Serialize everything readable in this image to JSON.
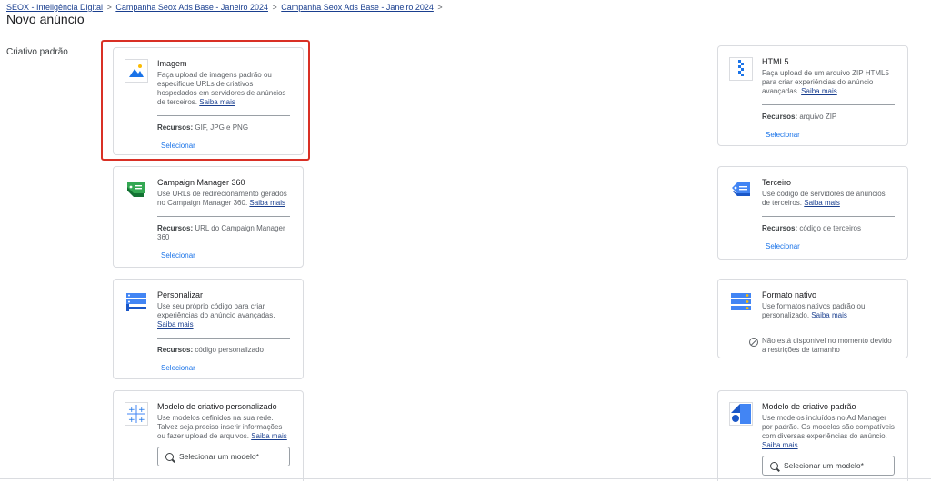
{
  "breadcrumb": {
    "items": [
      "SEOX - Inteligência Digital",
      "Campanha Seox Ads Base - Janeiro 2024",
      "Campanha Seox Ads Base - Janeiro 2024"
    ],
    "separator": ">"
  },
  "page_title": "Novo anúncio",
  "section_label": "Criativo padrão",
  "cards": {
    "imagem": {
      "title": "Imagem",
      "desc": "Faça upload de imagens padrão ou especifique URLs de criativos hospedados em servidores de anúncios de terceiros.",
      "learn_more": "Saiba mais",
      "res_label": "Recursos:",
      "res_value": "GIF, JPG e PNG",
      "action": "Selecionar"
    },
    "html5": {
      "title": "HTML5",
      "desc": "Faça upload de um arquivo ZIP HTML5 para criar experiências do anúncio avançadas.",
      "learn_more": "Saiba mais",
      "res_label": "Recursos:",
      "res_value": "arquivo ZIP",
      "action": "Selecionar"
    },
    "cm360": {
      "title": "Campaign Manager 360",
      "desc": "Use URLs de redirecionamento gerados no Campaign Manager 360.",
      "learn_more": "Saiba mais",
      "res_label": "Recursos:",
      "res_value": "URL do Campaign Manager 360",
      "action": "Selecionar"
    },
    "terceiro": {
      "title": "Terceiro",
      "desc": "Use código de servidores de anúncios de terceiros.",
      "learn_more": "Saiba mais",
      "res_label": "Recursos:",
      "res_value": "código de terceiros",
      "action": "Selecionar"
    },
    "personalizar": {
      "title": "Personalizar",
      "desc": "Use seu próprio código para criar experiências do anúncio avançadas.",
      "learn_more": "Saiba mais",
      "res_label": "Recursos:",
      "res_value": "código personalizado",
      "action": "Selecionar"
    },
    "nativo": {
      "title": "Formato nativo",
      "desc": "Use formatos nativos padrão ou personalizado.",
      "learn_more": "Saiba mais",
      "unavailable": "Não está disponível no momento devido a restrições de tamanho"
    },
    "modelo_personalizado": {
      "title": "Modelo de criativo personalizado",
      "desc": "Use modelos definidos na sua rede. Talvez seja preciso inserir informações ou fazer upload de arquivos.",
      "learn_more": "Saiba mais",
      "select_placeholder": "Selecionar um modelo*"
    },
    "modelo_padrao": {
      "title": "Modelo de criativo padrão",
      "desc": "Use modelos incluídos no Ad Manager por padrão. Os modelos são compatíveis com diversas experiências do anúncio.",
      "learn_more": "Saiba mais",
      "select_placeholder": "Selecionar um modelo*"
    }
  },
  "colors": {
    "highlight": "#d93025",
    "link": "#1a73e8",
    "icon_blue": "#4285f4",
    "icon_green": "#34a853"
  }
}
